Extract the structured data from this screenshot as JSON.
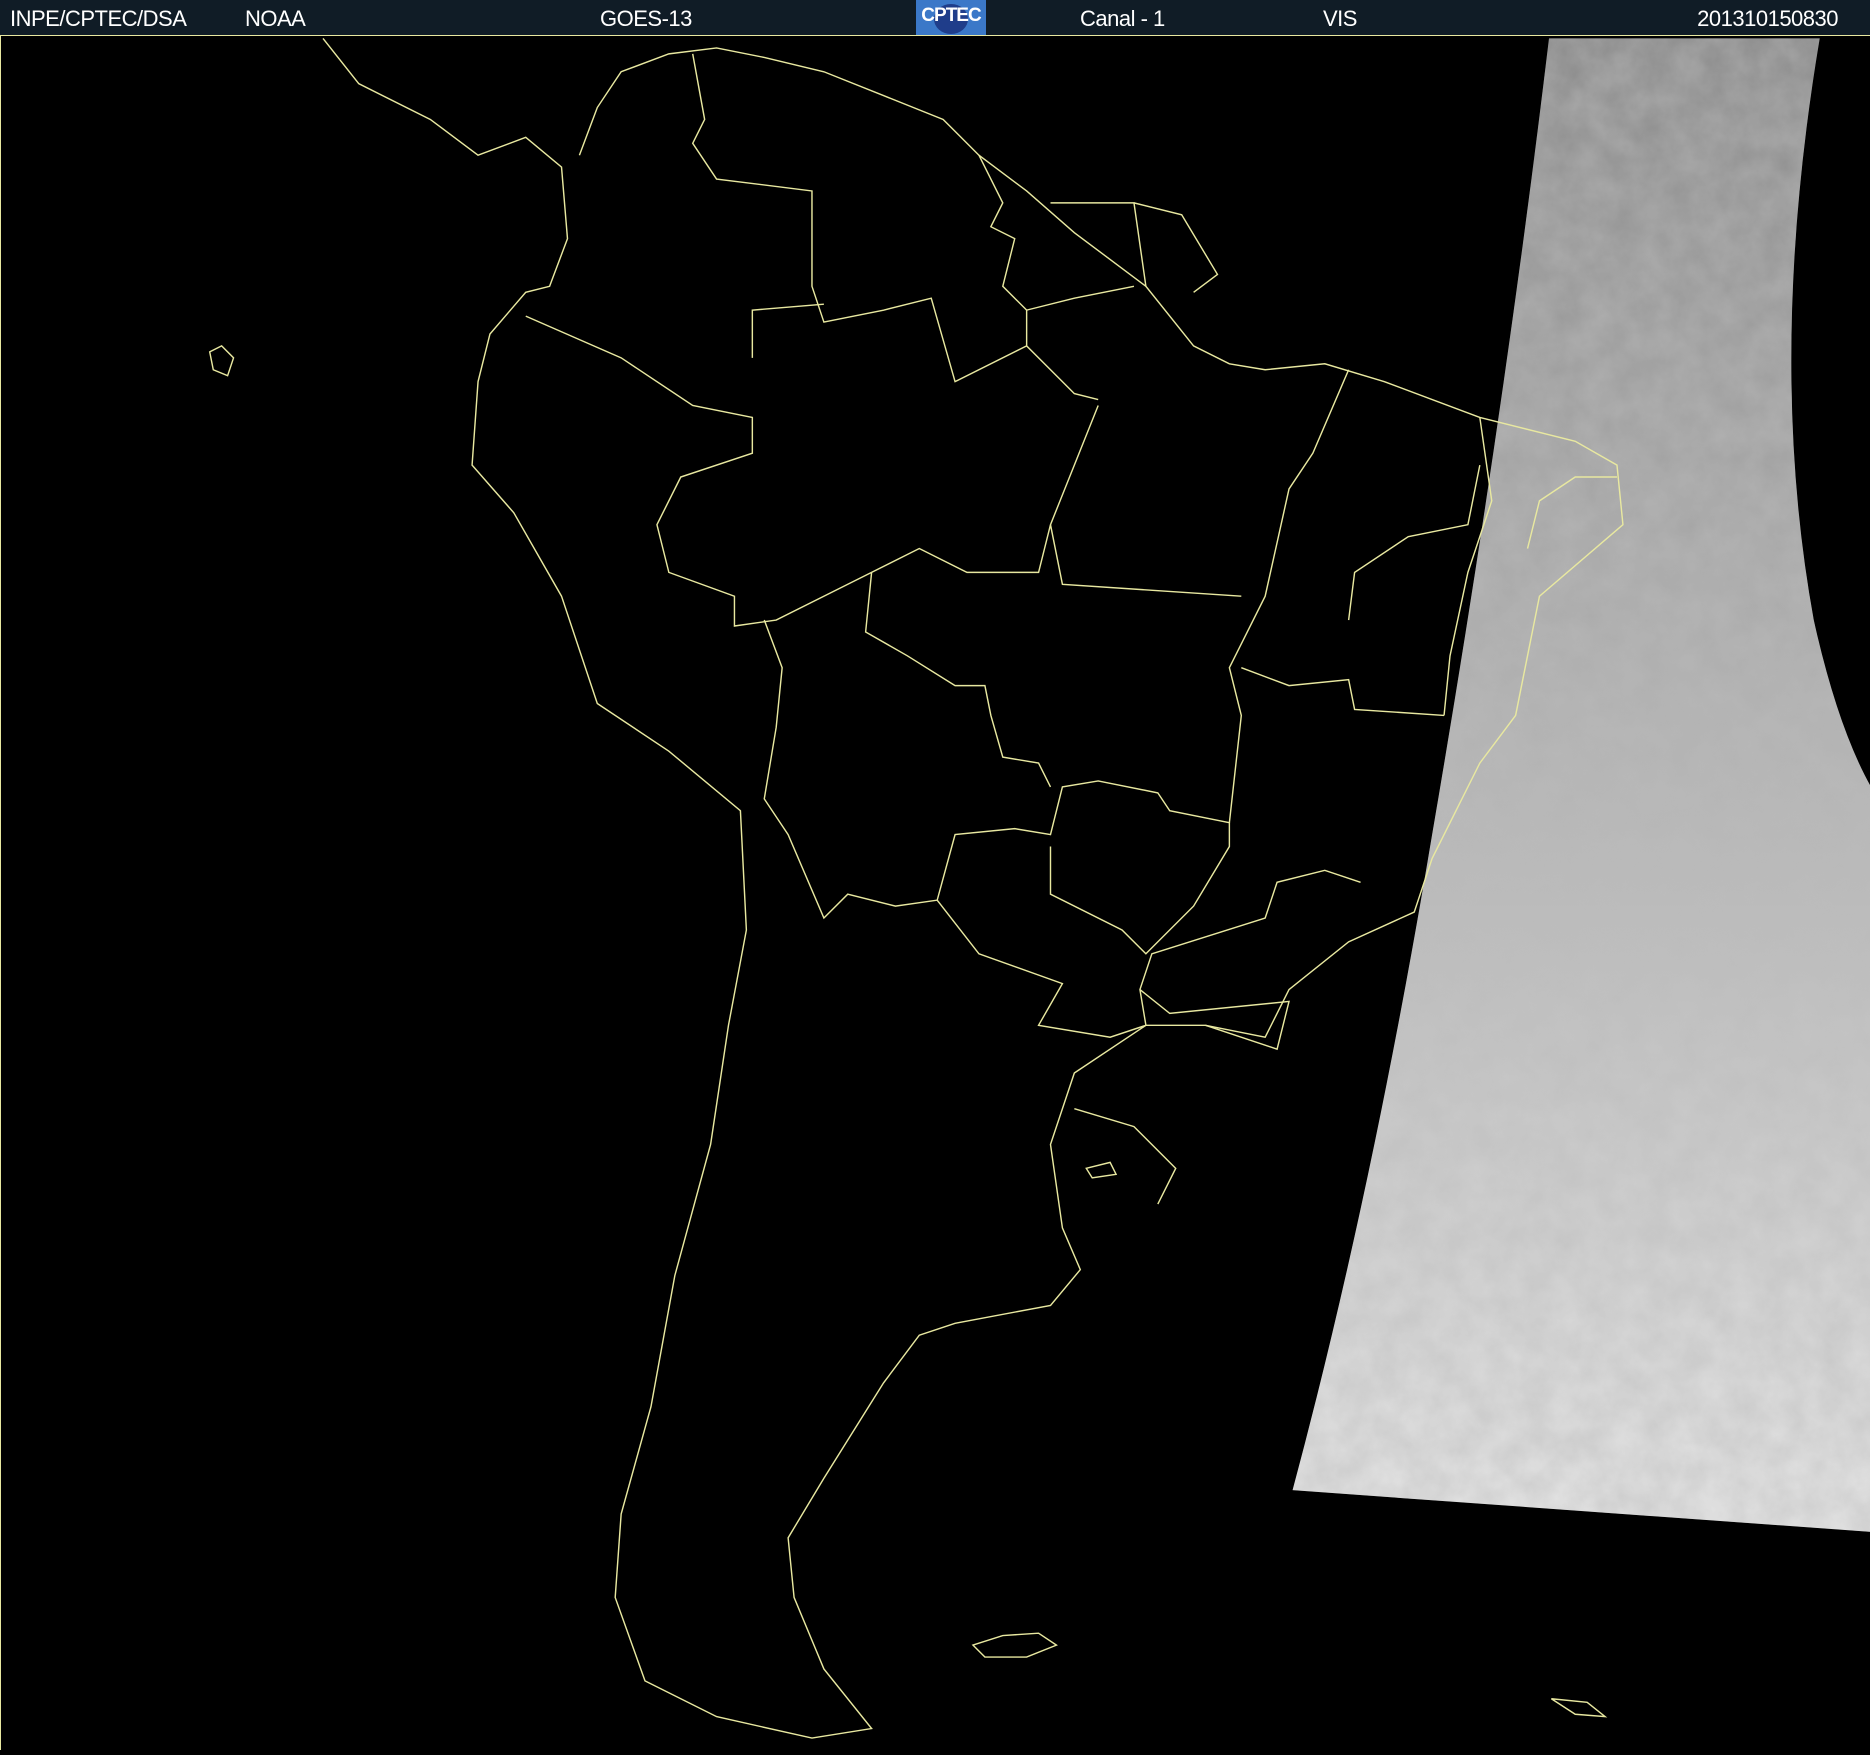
{
  "header": {
    "agency": "INPE/CPTEC/DSA",
    "source": "NOAA",
    "satellite": "GOES-13",
    "logo_text": "CPTEC",
    "channel": "Canal - 1",
    "band": "VIS",
    "timestamp": "201310150830"
  },
  "colors": {
    "header_bg": "#101c26",
    "outline": "#e8e8a0",
    "background": "#000000"
  }
}
